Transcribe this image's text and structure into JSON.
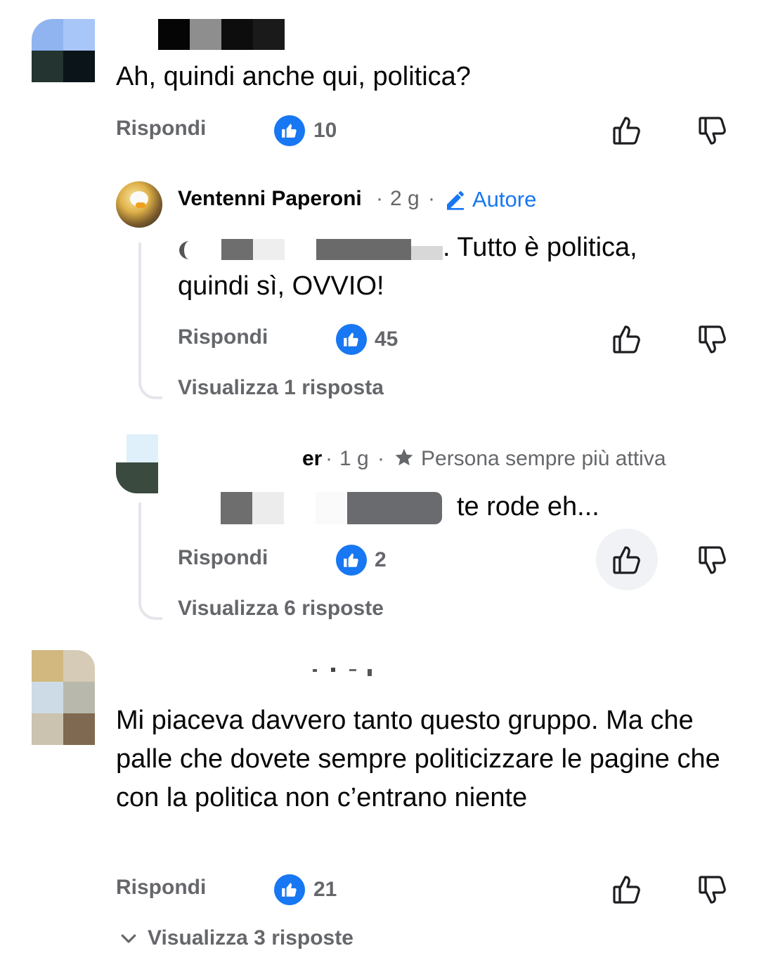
{
  "comments": [
    {
      "text": "Ah, quindi anche qui, politica?",
      "reply_label": "Rispondi",
      "likes": "10"
    },
    {
      "author": "Ventenni Paperoni",
      "time": "2 g",
      "badge": "Autore",
      "text_suffix": ". Tutto è politica,",
      "text_line2": "quindi sì, OVVIO!",
      "reply_label": "Rispondi",
      "likes": "45",
      "view_replies": "Visualizza 1 risposta"
    },
    {
      "author_fragment": "er",
      "time": "1 g",
      "badge": "Persona sempre più attiva",
      "text_suffix": "te rode eh...",
      "reply_label": "Rispondi",
      "likes": "2",
      "view_replies": "Visualizza 6 risposte"
    },
    {
      "text": "Mi piaceva davvero tanto questo gruppo. Ma che palle che dovete sempre politicizzare le pagine che con la politica non c’entrano niente",
      "reply_label": "Rispondi",
      "likes": "21",
      "view_replies": "Visualizza 3 risposte"
    }
  ],
  "separator": "·",
  "colors": {
    "accent": "#1877f2",
    "muted": "#65676b",
    "text": "#050505"
  },
  "icons": [
    "thumbs-up-icon",
    "thumbs-down-icon",
    "pencil-icon",
    "star-icon",
    "chevron-down-icon"
  ]
}
